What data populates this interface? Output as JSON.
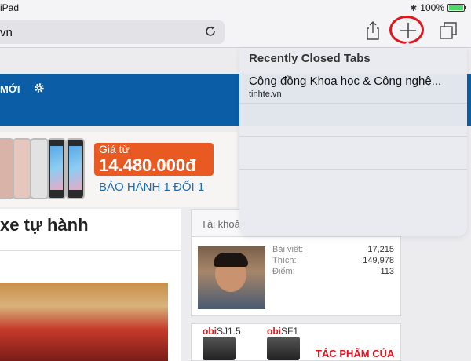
{
  "status_bar": {
    "carrier": "iPad",
    "battery_label": "100%",
    "battery_level": 1.0,
    "battery_color": "#4cd964"
  },
  "toolbar": {
    "url_text": "vn",
    "icons": [
      "reload-icon",
      "share-icon",
      "new-tab-icon",
      "tabs-icon"
    ],
    "highlight_color": "#e0161e"
  },
  "nav": {
    "item_label": "MỚI",
    "icons": [
      "gear-icon"
    ],
    "bar_color": "#0b5ea6"
  },
  "banner": {
    "price_prefix": "Giá từ",
    "price_value": "14.480.000đ",
    "warranty": "BẢO HÀNH 1 ĐỔI 1",
    "accent_color": "#e85a22"
  },
  "article": {
    "headline": "xe tự hành"
  },
  "account_panel": {
    "header": "Tài khoản",
    "stats": [
      {
        "label": "Bài viết:",
        "value": "17,215"
      },
      {
        "label": "Thích:",
        "value": "149,978"
      },
      {
        "label": "Điểm:",
        "value": "113"
      }
    ]
  },
  "ad": {
    "models": [
      {
        "brand": "obi",
        "model": "SJ1.5"
      },
      {
        "brand": "obi",
        "model": "SF1"
      }
    ],
    "tagline": "TÁC PHẨM CỦA"
  },
  "recently_closed": {
    "title": "Recently Closed Tabs",
    "items": [
      {
        "title": "Cộng đồng Khoa học & Công nghệ...",
        "domain": "tinhte.vn"
      },
      {
        "title": "",
        "domain": ""
      },
      {
        "title": "",
        "domain": ""
      },
      {
        "title": "",
        "domain": ""
      }
    ]
  }
}
